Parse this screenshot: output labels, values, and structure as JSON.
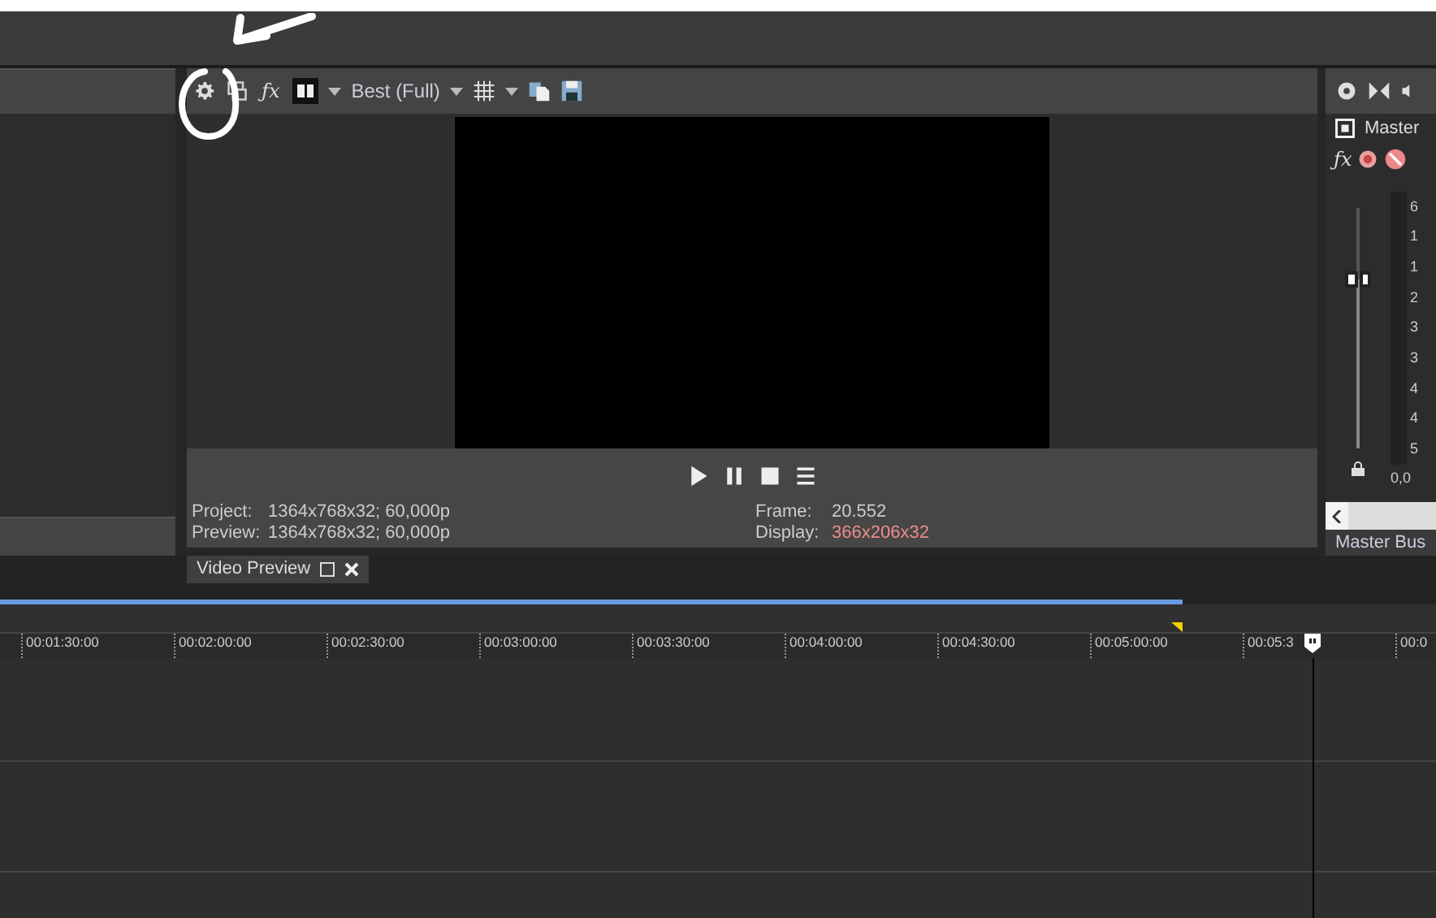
{
  "preview_toolbar": {
    "fx": "ƒx",
    "quality": "Best (Full)"
  },
  "preview": {
    "info": [
      {
        "label": "Project:",
        "value": "1364x768x32; 60,000p"
      },
      {
        "label": "Preview:",
        "value": "1364x768x32; 60,000p"
      }
    ],
    "stats": [
      {
        "label": "Frame:",
        "value": "20.552",
        "highlight": false
      },
      {
        "label": "Display:",
        "value": "366x206x32",
        "highlight": true
      }
    ]
  },
  "preview_tab": {
    "label": "Video Preview"
  },
  "mixer": {
    "channel": "Master",
    "fx": "ƒx",
    "fader": {
      "level": 0.7
    },
    "meter_scale": [
      "6",
      "1",
      "1",
      "2",
      "3",
      "3",
      "4",
      "4",
      "5"
    ],
    "reading": "0,0",
    "footer": "Master Bus"
  },
  "timeline": {
    "ticks": [
      "00:01:30:00",
      "00:02:00:00",
      "00:02:30:00",
      "00:03:00:00",
      "00:03:30:00",
      "00:04:00:00",
      "00:04:30:00",
      "00:05:00:00",
      "00:05:3",
      "00:0"
    ]
  }
}
